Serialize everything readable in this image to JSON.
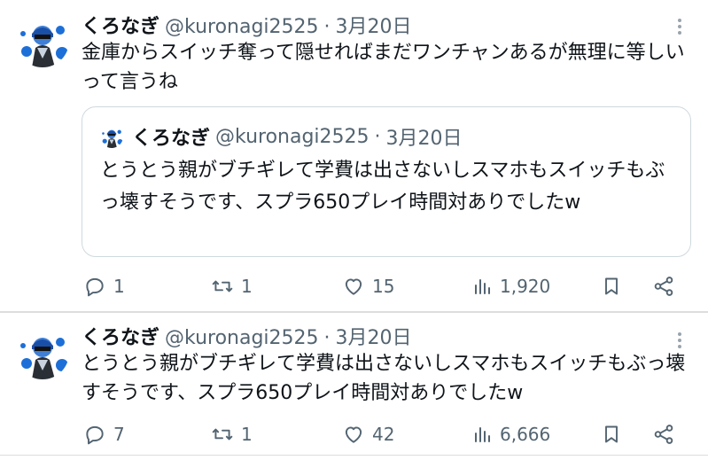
{
  "tweets": [
    {
      "author": "くろなぎ",
      "handle": "@kuronagi2525",
      "separator": "·",
      "date": "3月20日",
      "text": "金庫からスイッチ奪って隠せればまだワンチャンあるが無理に等しいって言うね",
      "quote": {
        "author": "くろなぎ",
        "handle": "@kuronagi2525",
        "separator": "·",
        "date": "3月20日",
        "text": "とうとう親がブチギレて学費は出さないしスマホもスイッチもぶっ壊すそうです、スプラ650プレイ時間対ありでしたw"
      },
      "stats": {
        "replies": "1",
        "retweets": "1",
        "likes": "15",
        "views": "1,920"
      }
    },
    {
      "author": "くろなぎ",
      "handle": "@kuronagi2525",
      "separator": "·",
      "date": "3月20日",
      "text": "とうとう親がブチギレて学費は出さないしスマホもスイッチもぶっ壊すそうです、スプラ650プレイ時間対ありでしたw",
      "stats": {
        "replies": "7",
        "retweets": "1",
        "likes": "42",
        "views": "6,666"
      }
    }
  ],
  "icons": {
    "reply": "reply-icon",
    "retweet": "retweet-icon",
    "like": "heart-icon",
    "views": "views-icon",
    "bookmark": "bookmark-icon",
    "share": "share-icon",
    "more": "more-icon"
  },
  "colors": {
    "text": "#0f1419",
    "secondary": "#536471",
    "border": "#cfd9de",
    "avatar_accent": "#1d6fd8"
  }
}
